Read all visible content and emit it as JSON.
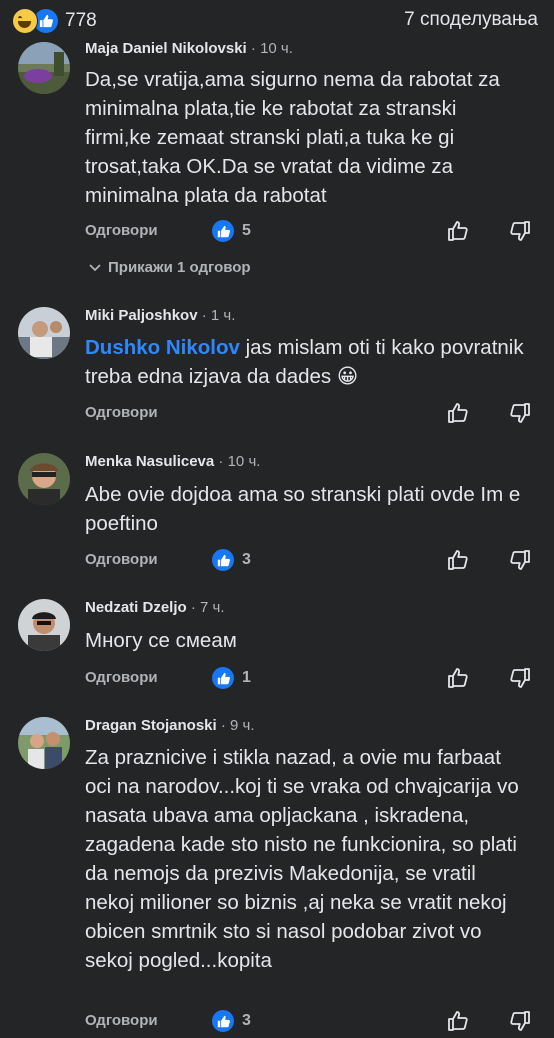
{
  "header": {
    "reaction_count": "778",
    "shares": "7 споделувања"
  },
  "comments": [
    {
      "name": "Maja Daniel Nikolovski",
      "time": "10 ч.",
      "text": "Da,se vratija,ama sigurno nema da rabotat za minimalna plata,tie ke rabotat za stranski firmi,ke zemaat stranski plati,a tuka ke gi trosat,taka OK.Da se vratat da vidime za minimalna plata da rabotat",
      "reply_label": "Одговори",
      "likes": "5",
      "show_replies": "Прикажи 1 одговор"
    },
    {
      "name": "Miki Paljoshkov",
      "time": "1 ч.",
      "mention": "Dushko Nikolov",
      "text": " jas mislam oti ti kako povratnik treba edna izjava da dades",
      "emoji": "😀",
      "reply_label": "Одговори"
    },
    {
      "name": "Menka Nasuliceva",
      "time": "10 ч.",
      "text": "Abe ovie dojdoa ama so stranski plati ovde Im e poeftino",
      "reply_label": "Одговори",
      "likes": "3"
    },
    {
      "name": "Nedzati Dzeljo",
      "time": "7 ч.",
      "text": "Многу се смеам",
      "reply_label": "Одговори",
      "likes": "1"
    },
    {
      "name": "Dragan Stojanoski",
      "time": "9 ч.",
      "text": "Za praznicive i stikla nazad, a ovie mu farbaat oci na narodov...koj ti se vraka od chvajcarija vo nasata ubava ama opljackana , iskradena, zagadena kade sto nisto ne funkcionira, so plati da nemojs da prezivis Makedonija, se vratil nekoj milioner so biznis ,aj neka se vratit nekoj obicen smrtnik sto si nasol podobar zivot vo sekoj pogled...kopita",
      "reply_label": "Одговори",
      "likes": "3"
    }
  ],
  "sep": " · ",
  "colors": {
    "background": "#242526",
    "accent": "#1877f2",
    "mention": "#2d88ff",
    "muted": "#b0b3b8",
    "text": "#e4e6eb"
  },
  "icons": [
    "laugh-reaction-icon",
    "like-reaction-icon",
    "thumb-up-icon",
    "thumb-down-icon",
    "chevron-down-icon"
  ]
}
